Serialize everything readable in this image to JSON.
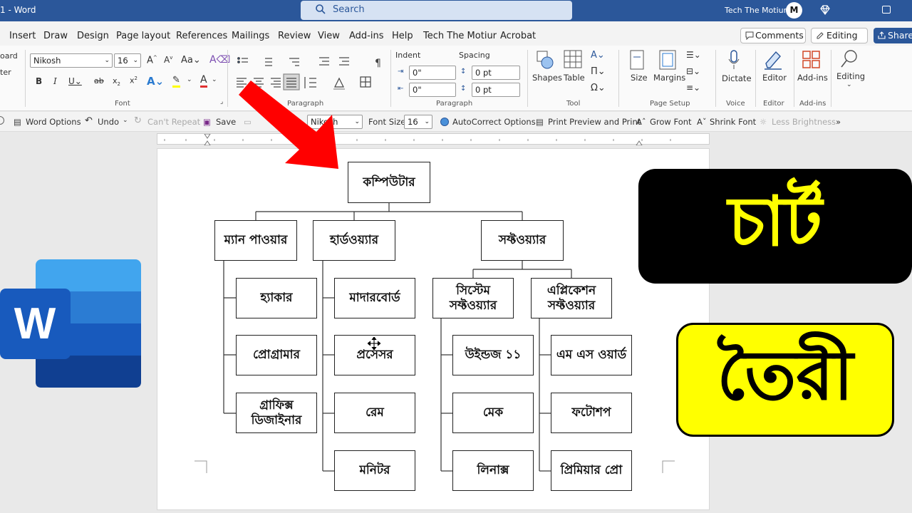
{
  "titlebar": {
    "doc_title": "1 - Word",
    "search": "Search",
    "user": "Tech The Motiur",
    "avatar_letter": "M"
  },
  "menu": {
    "items": [
      "Insert",
      "Draw",
      "Design",
      "Page layout",
      "References",
      "Mailings",
      "Review",
      "View",
      "Add-ins",
      "Help",
      "Tech The Motiur",
      "Acrobat"
    ],
    "comments": "Comments",
    "editing": "Editing",
    "share": "Share"
  },
  "ribbon": {
    "clipboard_partial": "oard",
    "clipboard_partial2": "ter",
    "font_name": "Nikosh",
    "font_size": "16",
    "font_group": "Font",
    "paragraph_group": "Paragraph",
    "indent_label": "Indent",
    "spacing_label": "Spacing",
    "indent_left": "0\"",
    "indent_right": "0\"",
    "spacing_before": "0 pt",
    "spacing_after": "0 pt",
    "paragraph_group2": "Paragraph",
    "shapes": "Shapes",
    "table": "Table",
    "tool_group": "Tool",
    "size": "Size",
    "margins": "Margins",
    "page_setup_group": "Page Setup",
    "dictate": "Dictate",
    "voice_group": "Voice",
    "editor": "Editor",
    "editor_group": "Editor",
    "addins": "Add-ins",
    "addins_group": "Add-ins",
    "editing": "Editing"
  },
  "qat": {
    "word_options": "Word Options",
    "undo": "Undo",
    "cant_repeat": "Can't Repeat",
    "save": "Save",
    "font": "Nikosh",
    "font_size_label": "Font Size:",
    "font_size": "16",
    "autocorrect": "AutoCorrect Options",
    "print_preview": "Print Preview and Print",
    "grow_font": "Grow Font",
    "shrink_font": "Shrink Font",
    "less_brightness": "Less Brightness",
    "more": "»"
  },
  "chart": {
    "root": "কম্পিউটার",
    "manpower": "ম্যান পাওয়ার",
    "hardware": "হার্ডওয়্যার",
    "software": "সফ্টওয়্যার",
    "hacker": "হ্যাকার",
    "programmer": "প্রোগ্রামার",
    "graphics1": "গ্রাফিক্স",
    "graphics2": "ডিজাইনার",
    "motherboard": "মাদারবোর্ড",
    "processor": "প্রসেসর",
    "ram": "রেম",
    "monitor": "মনিটর",
    "system1": "সিস্টেম",
    "system2": "সফ্টওয়্যার",
    "application1": "এপ্লিকেশন",
    "application2": "সফ্টওয়্যার",
    "windows": "উইন্ডজ ১১",
    "mac": "মেক",
    "linux": "লিনাক্স",
    "msword": "এম এস ওয়ার্ড",
    "photoshop": "ফটোশপ",
    "premiere": "প্রিমিয়ার প্রো"
  },
  "banner": {
    "top": "চার্ট",
    "bottom": "তৈরী"
  },
  "colors": {
    "word_blue": "#2b579a",
    "arrow_red": "#ff0000",
    "banner_yellow": "#ffff00"
  }
}
